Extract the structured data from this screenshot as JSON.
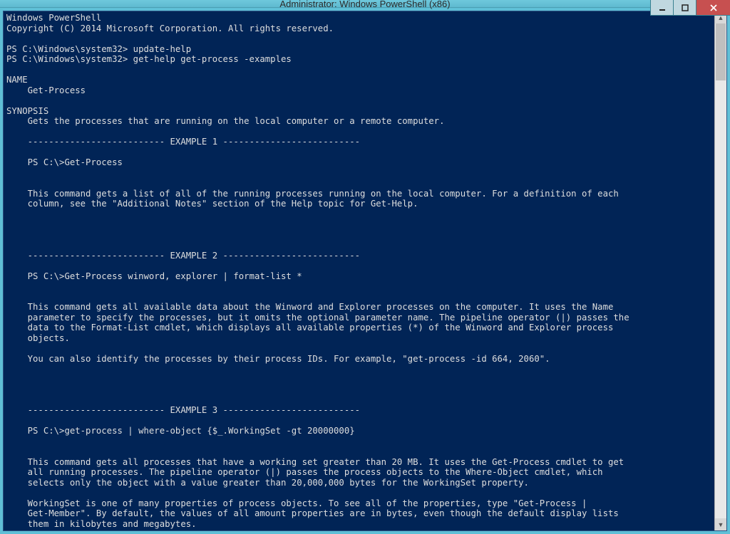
{
  "window": {
    "title": "Administrator: Windows PowerShell (x86)"
  },
  "terminal": {
    "lines": [
      "Windows PowerShell",
      "Copyright (C) 2014 Microsoft Corporation. All rights reserved.",
      "",
      "PS C:\\Windows\\system32> update-help",
      "PS C:\\Windows\\system32> get-help get-process -examples",
      "",
      "NAME",
      "    Get-Process",
      "",
      "SYNOPSIS",
      "    Gets the processes that are running on the local computer or a remote computer.",
      "",
      "    -------------------------- EXAMPLE 1 --------------------------",
      "",
      "    PS C:\\>Get-Process",
      "",
      "",
      "    This command gets a list of all of the running processes running on the local computer. For a definition of each",
      "    column, see the \"Additional Notes\" section of the Help topic for Get-Help.",
      "",
      "",
      "",
      "",
      "    -------------------------- EXAMPLE 2 --------------------------",
      "",
      "    PS C:\\>Get-Process winword, explorer | format-list *",
      "",
      "",
      "    This command gets all available data about the Winword and Explorer processes on the computer. It uses the Name",
      "    parameter to specify the processes, but it omits the optional parameter name. The pipeline operator (|) passes the",
      "    data to the Format-List cmdlet, which displays all available properties (*) of the Winword and Explorer process",
      "    objects.",
      "",
      "    You can also identify the processes by their process IDs. For example, \"get-process -id 664, 2060\".",
      "",
      "",
      "",
      "",
      "    -------------------------- EXAMPLE 3 --------------------------",
      "",
      "    PS C:\\>get-process | where-object {$_.WorkingSet -gt 20000000}",
      "",
      "",
      "    This command gets all processes that have a working set greater than 20 MB. It uses the Get-Process cmdlet to get",
      "    all running processes. The pipeline operator (|) passes the process objects to the Where-Object cmdlet, which",
      "    selects only the object with a value greater than 20,000,000 bytes for the WorkingSet property.",
      "",
      "    WorkingSet is one of many properties of process objects. To see all of the properties, type \"Get-Process |",
      "    Get-Member\". By default, the values of all amount properties are in bytes, even though the default display lists",
      "    them in kilobytes and megabytes."
    ]
  }
}
